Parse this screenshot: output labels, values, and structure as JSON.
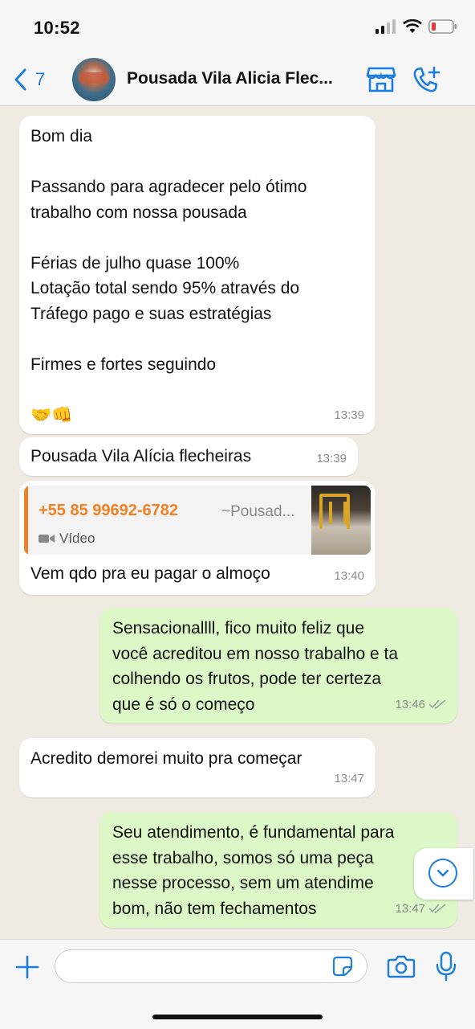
{
  "status": {
    "time": "10:52"
  },
  "header": {
    "back_count": "7",
    "title": "Pousada Vila Alicia Flec...",
    "store_icon": "storefront-icon",
    "call_icon": "add-call-icon"
  },
  "messages": [
    {
      "type": "in",
      "text": "Bom dia\n\nPassando para agradecer pelo ótimo\ntrabalho com nossa pousada\n\nFérias de julho quase 100%\nLotação total sendo 95% através do\nTráfego pago e suas estratégias\n\nFirmes e fortes seguindo\n\n🤝👊",
      "time": "13:39"
    },
    {
      "type": "in",
      "text": "Pousada Vila Alícia flecheiras",
      "time": "13:39"
    },
    {
      "type": "in",
      "quote_name": "+55 85 99692-6782",
      "quote_pushname": "~Pousad...",
      "quote_media": "Vídeo",
      "text": "Vem qdo pra eu pagar o almoço",
      "time": "13:40"
    },
    {
      "type": "out",
      "text": "Sensacionallll, fico muito feliz que\nvocê acreditou em nosso trabalho e ta\ncolhendo os frutos, pode ter certeza\nque é só o começo",
      "time": "13:46"
    },
    {
      "type": "in",
      "text": "Acredito demorei muito pra começar",
      "time": "13:47"
    },
    {
      "type": "out",
      "text": "Seu atendimento, é fundamental para\nesse trabalho, somos só uma peça\nnesse processo, sem um atendime\nbom, não tem fechamentos",
      "time": "13:47"
    }
  ],
  "composer": {
    "placeholder": ""
  },
  "colors": {
    "accent": "#1b7ddd",
    "incoming": "#ffffff",
    "outgoing": "#dcf8c6",
    "quote_accent": "#f08024"
  }
}
